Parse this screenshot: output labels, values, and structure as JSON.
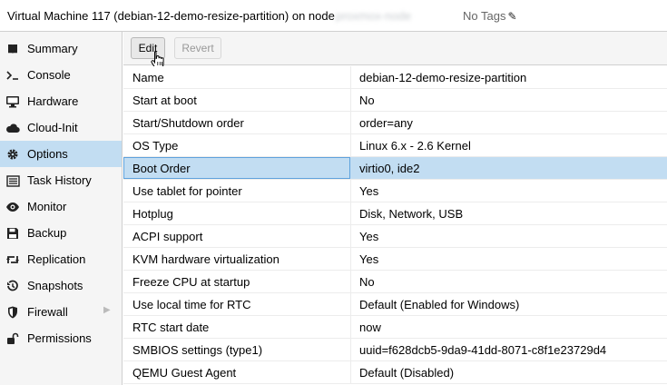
{
  "header": {
    "title": "Virtual Machine 117 (debian-12-demo-resize-partition) on node",
    "node_name": "proxmox-node",
    "tags_label": "No Tags"
  },
  "sidebar": {
    "items": [
      {
        "label": "Summary",
        "icon": "book-icon"
      },
      {
        "label": "Console",
        "icon": "terminal-icon"
      },
      {
        "label": "Hardware",
        "icon": "desktop-icon"
      },
      {
        "label": "Cloud-Init",
        "icon": "cloud-icon"
      },
      {
        "label": "Options",
        "icon": "gear-icon"
      },
      {
        "label": "Task History",
        "icon": "list-icon"
      },
      {
        "label": "Monitor",
        "icon": "eye-icon"
      },
      {
        "label": "Backup",
        "icon": "floppy-icon"
      },
      {
        "label": "Replication",
        "icon": "retweet-icon"
      },
      {
        "label": "Snapshots",
        "icon": "history-icon"
      },
      {
        "label": "Firewall",
        "icon": "shield-icon"
      },
      {
        "label": "Permissions",
        "icon": "unlock-icon"
      }
    ],
    "active": "Options"
  },
  "toolbar": {
    "edit_label": "Edit",
    "revert_label": "Revert"
  },
  "options": {
    "rows": [
      {
        "key": "Name",
        "value": "debian-12-demo-resize-partition"
      },
      {
        "key": "Start at boot",
        "value": "No"
      },
      {
        "key": "Start/Shutdown order",
        "value": "order=any"
      },
      {
        "key": "OS Type",
        "value": "Linux 6.x - 2.6 Kernel"
      },
      {
        "key": "Boot Order",
        "value": "virtio0, ide2"
      },
      {
        "key": "Use tablet for pointer",
        "value": "Yes"
      },
      {
        "key": "Hotplug",
        "value": "Disk, Network, USB"
      },
      {
        "key": "ACPI support",
        "value": "Yes"
      },
      {
        "key": "KVM hardware virtualization",
        "value": "Yes"
      },
      {
        "key": "Freeze CPU at startup",
        "value": "No"
      },
      {
        "key": "Use local time for RTC",
        "value": "Default (Enabled for Windows)"
      },
      {
        "key": "RTC start date",
        "value": "now"
      },
      {
        "key": "SMBIOS settings (type1)",
        "value": "uuid=f628dcb5-9da9-41dd-8071-c8f1e23729d4"
      },
      {
        "key": "QEMU Guest Agent",
        "value": "Default (Disabled)"
      }
    ],
    "selected": "Boot Order"
  },
  "colors": {
    "selection": "#c2ddf2",
    "selection_border": "#5fa2dd",
    "sidebar_bg": "#f5f5f5"
  }
}
